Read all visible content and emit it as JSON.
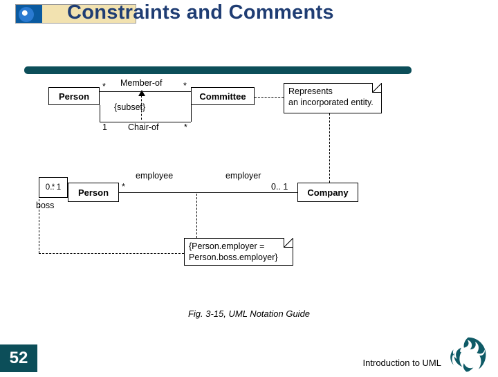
{
  "header": {
    "title": "Constraints and Comments"
  },
  "diagram": {
    "top": {
      "person": "Person",
      "committee": "Committee",
      "memberOf": "Member-of",
      "chairOf": "Chair-of",
      "subset": "{subset}",
      "multA": "*",
      "multB": "*",
      "multC": "1",
      "multD": "*"
    },
    "mid": {
      "person": "Person",
      "company": "Company",
      "employee": "employee",
      "employer": "employer",
      "empMult": "*",
      "compMult": "0.. 1",
      "selfTop": "*",
      "selfBottom": "0.. 1",
      "boss": "boss"
    },
    "noteTop": "Represents\nan incorporated entity.",
    "noteBottom": "{Person.employer =\nPerson.boss.employer}"
  },
  "caption": "Fig. 3-15, UML Notation Guide",
  "footer": {
    "page": "52",
    "intro": "Introduction to UML"
  }
}
